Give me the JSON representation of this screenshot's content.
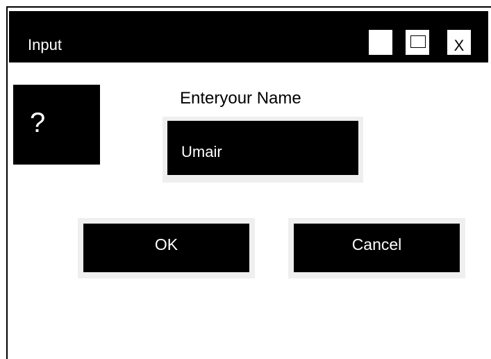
{
  "window": {
    "title": "Input",
    "controls": {
      "minimize_icon": "minimize-icon",
      "maximize_icon": "maximize-icon",
      "close_label": "X"
    }
  },
  "dialog": {
    "icon": {
      "name": "question-icon",
      "glyph": "?"
    },
    "prompt": "Enteryour Name",
    "input_value": "Umair",
    "ok_label": "OK",
    "cancel_label": "Cancel"
  },
  "colors": {
    "background": "#ffffff",
    "foreground": "#000000",
    "frame": "#efefef"
  }
}
